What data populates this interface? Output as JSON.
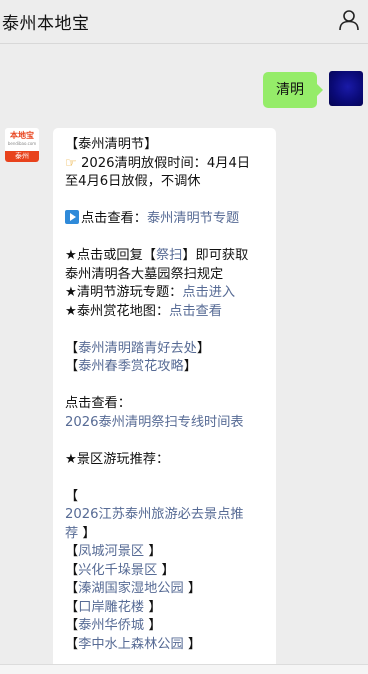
{
  "header": {
    "title": "泰州本地宝",
    "user_icon": "user-icon"
  },
  "outgoing": {
    "text": "清明"
  },
  "bot": {
    "logo_text": "本地宝",
    "logo_sub": "bendibao.com",
    "logo_city": "泰州"
  },
  "message": {
    "l1": "【泰州清明节】",
    "l2": "2026清明放假时间：4月4日",
    "l3": "至4月6日放假，不调休",
    "l4a": "点击查看：",
    "l4b": "泰州清明节专题",
    "l5a": "★点击或回复【",
    "l5b": "祭扫",
    "l5c": "】即可获取",
    "l6": "泰州清明各大墓园祭扫规定",
    "l7a": "★清明节游玩专题：",
    "l7b": "点击进入",
    "l8a": "★泰州赏花地图：",
    "l8b": "点击查看",
    "l9a": "【",
    "l9b": "泰州清明踏青好去处",
    "l9c": "】",
    "l10a": "【",
    "l10b": "泰州春季赏花攻略",
    "l10c": "】",
    "l11": "点击查看：",
    "l12": "2026泰州清明祭扫专线时间表",
    "l13": "★景区游玩推荐：",
    "l14": "【",
    "l15": "2026江苏泰州旅游必去景点推",
    "l16a": "荐",
    "l16b": "】",
    "spots": [
      "凤城河景区",
      "兴化千垛景区",
      "溱湖国家湿地公园",
      "口岸雕花楼",
      "泰州华侨城",
      "李中水上森林公园"
    ]
  }
}
